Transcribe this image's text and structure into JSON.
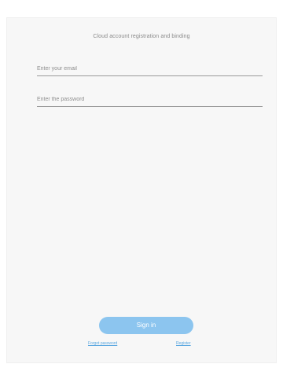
{
  "page": {
    "title": "Cloud account registration and binding"
  },
  "form": {
    "email_placeholder": "Enter your email",
    "email_value": "",
    "password_placeholder": "Enter the password",
    "password_value": "",
    "signin_label": "Sign in",
    "forgot_label": "Forgot password",
    "register_label": "Register"
  },
  "colors": {
    "accent": "#8cc5ef",
    "link": "#5aa7e0",
    "panel_bg": "#f7f7f7"
  }
}
